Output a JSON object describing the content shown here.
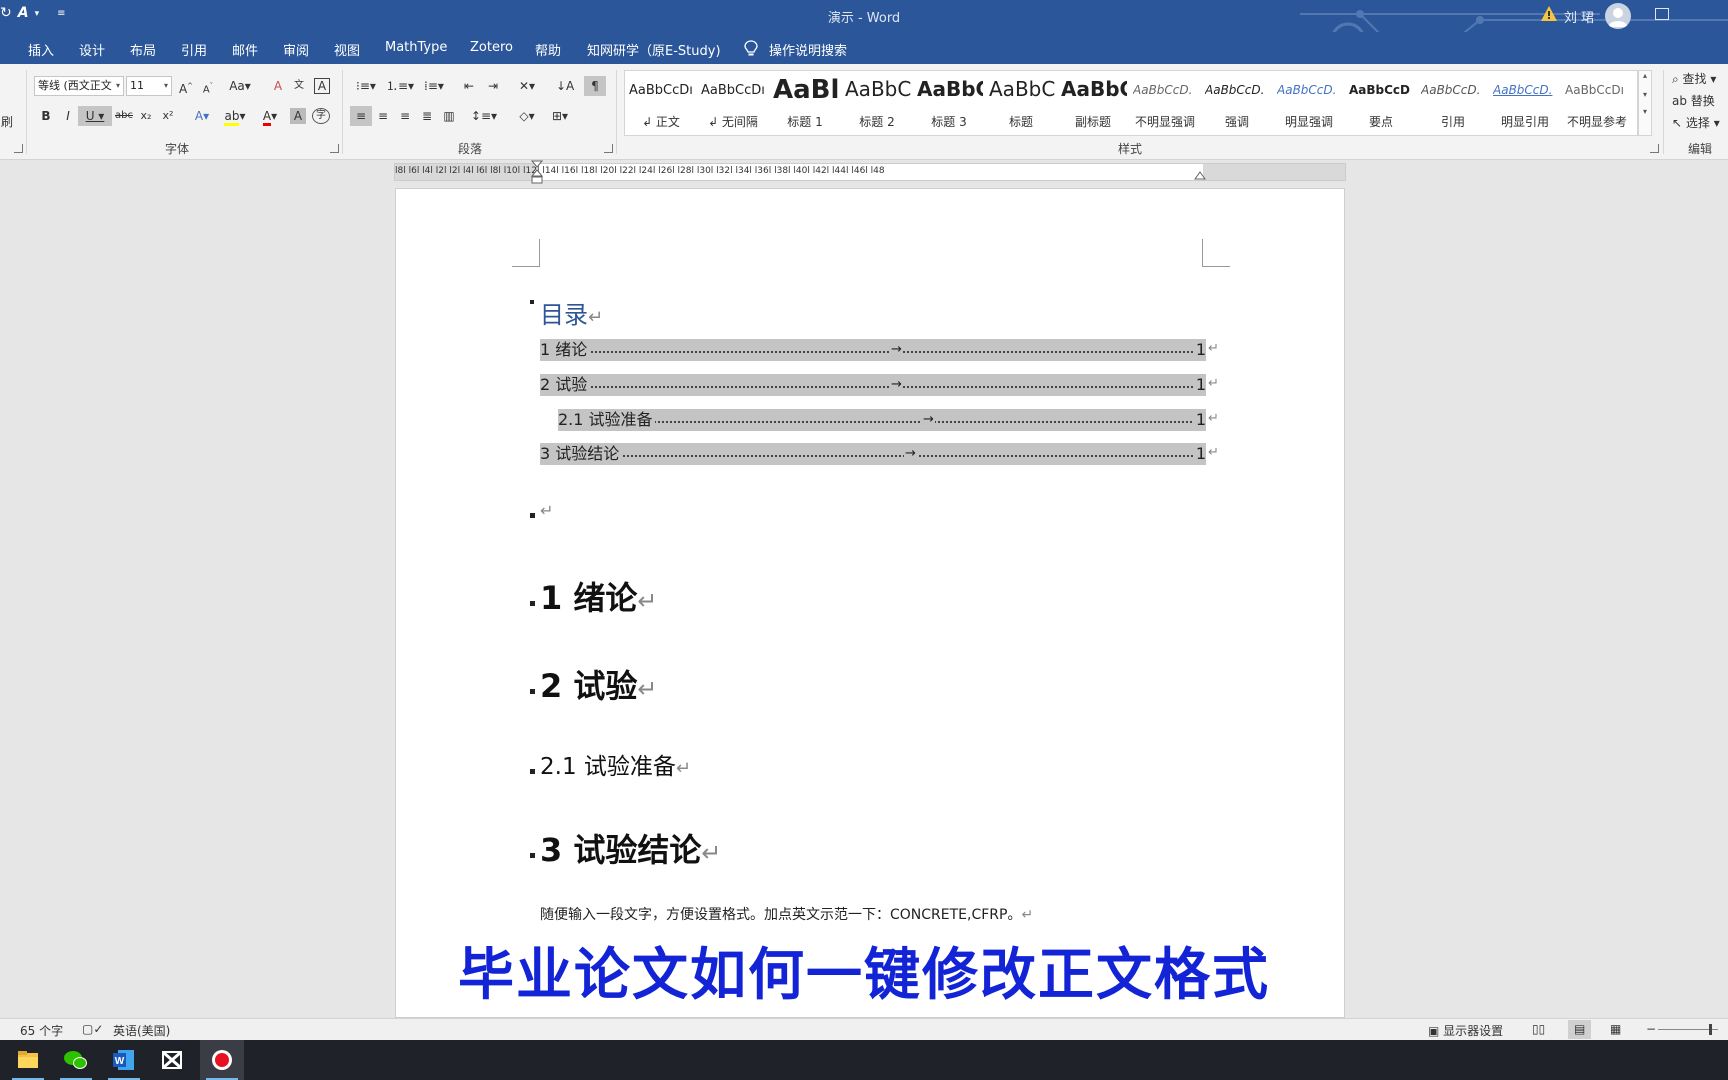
{
  "window": {
    "title": "演示 - Word",
    "user": "刘 珺"
  },
  "ribbon_tabs": [
    "插入",
    "设计",
    "布局",
    "引用",
    "邮件",
    "审阅",
    "视图",
    "MathType",
    "Zotero",
    "帮助",
    "知网研学（原E-Study)"
  ],
  "tell_me": "操作说明搜索",
  "font_group": {
    "font_name": "等线 (西文正文",
    "font_size": "11",
    "label": "字体"
  },
  "paragraph_group": {
    "label": "段落"
  },
  "styles_group": {
    "label": "样式",
    "items": [
      {
        "sample": "AaBbCcDı",
        "name": "↲ 正文"
      },
      {
        "sample": "AaBbCcDı",
        "name": "↲ 无间隔"
      },
      {
        "sample": "AaBl",
        "name": "标题 1"
      },
      {
        "sample": "AaBbC",
        "name": "标题 2"
      },
      {
        "sample": "AaBbC",
        "name": "标题 3"
      },
      {
        "sample": "AaBbC",
        "name": "标题"
      },
      {
        "sample": "AaBbC",
        "name": "副标题"
      },
      {
        "sample": "AaBbCcD.",
        "name": "不明显强调"
      },
      {
        "sample": "AaBbCcD.",
        "name": "强调"
      },
      {
        "sample": "AaBbCcD.",
        "name": "明显强调"
      },
      {
        "sample": "AaBbCcD",
        "name": "要点"
      },
      {
        "sample": "AaBbCcD.",
        "name": "引用"
      },
      {
        "sample": "AaBbCcD.",
        "name": "明显引用"
      },
      {
        "sample": "AaBbCcDı",
        "name": "不明显参考"
      }
    ]
  },
  "editing_group": {
    "label": "编辑",
    "find": "查找",
    "replace": "替换",
    "select": "选择"
  },
  "clipboard_fragment": "刷",
  "ruler": {
    "ticks": "l8l  l6l  l4l  l2l     l2l  l4l  l6l  l8l  l10l  l12l  l14l  l16l  l18l  l20l  l22l  l24l  l26l  l28l  l30l  l32l  l34l  l36l  l38l  l40l  l42l  l44l  l46l  l48"
  },
  "document": {
    "toc_title": "目录",
    "toc_entries": [
      {
        "label": "1 绪论",
        "page": "1"
      },
      {
        "label": "2 试验",
        "page": "1"
      },
      {
        "label": "2.1 试验准备",
        "page": "1"
      },
      {
        "label": "3 试验结论",
        "page": "1"
      }
    ],
    "headings": [
      {
        "text": "1 绪论",
        "level": 1
      },
      {
        "text": "2 试验",
        "level": 1
      },
      {
        "text": "2.1 试验准备",
        "level": 2
      },
      {
        "text": "3 试验结论",
        "level": 1
      }
    ],
    "body_text": "随便输入一段文字，方便设置格式。加点英文示范一下：CONCRETE,CFRP。",
    "para_mark": "↵",
    "tab_mark": "→"
  },
  "overlay_caption": "毕业论文如何一键修改正文格式",
  "status": {
    "word_count": "65 个字",
    "language": "英语(美国)",
    "display_settings": "显示器设置"
  },
  "colors": {
    "word_blue": "#2b579a",
    "toc_highlight": "#c4c4c4",
    "caption_blue": "#1224d6",
    "heading_blue": "#2f5597"
  }
}
